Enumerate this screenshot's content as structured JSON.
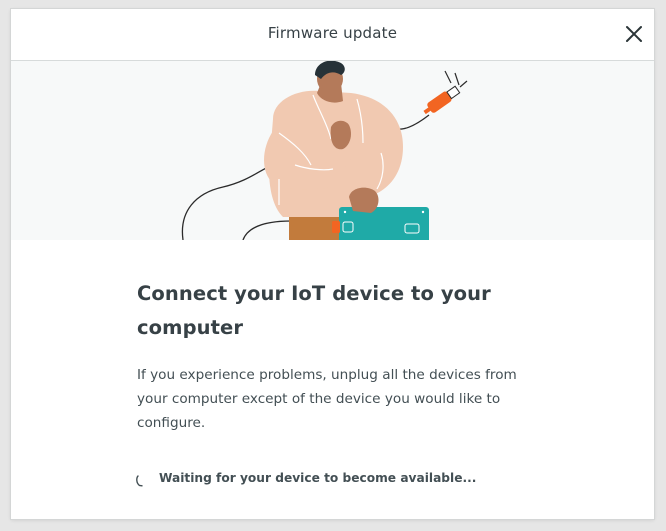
{
  "dialog": {
    "title": "Firmware update",
    "heading": "Connect your IoT device to your computer",
    "description": "If you experience problems, unplug all the devices from your computer except of the device you would like to configure.",
    "status_text": "Waiting for your device to become available..."
  },
  "icons": {
    "close": "close-icon",
    "spinner": "loading-spinner-icon",
    "illustration": "person-plugging-usb-into-board"
  },
  "colors": {
    "text_dark": "#374146",
    "text_body": "#434f54",
    "board_teal": "#1faaa7",
    "plug_orange": "#f26522",
    "shirt_peach": "#f1c9b1",
    "pants_brown": "#c27b3c",
    "hero_bg": "#f7f9f9"
  }
}
